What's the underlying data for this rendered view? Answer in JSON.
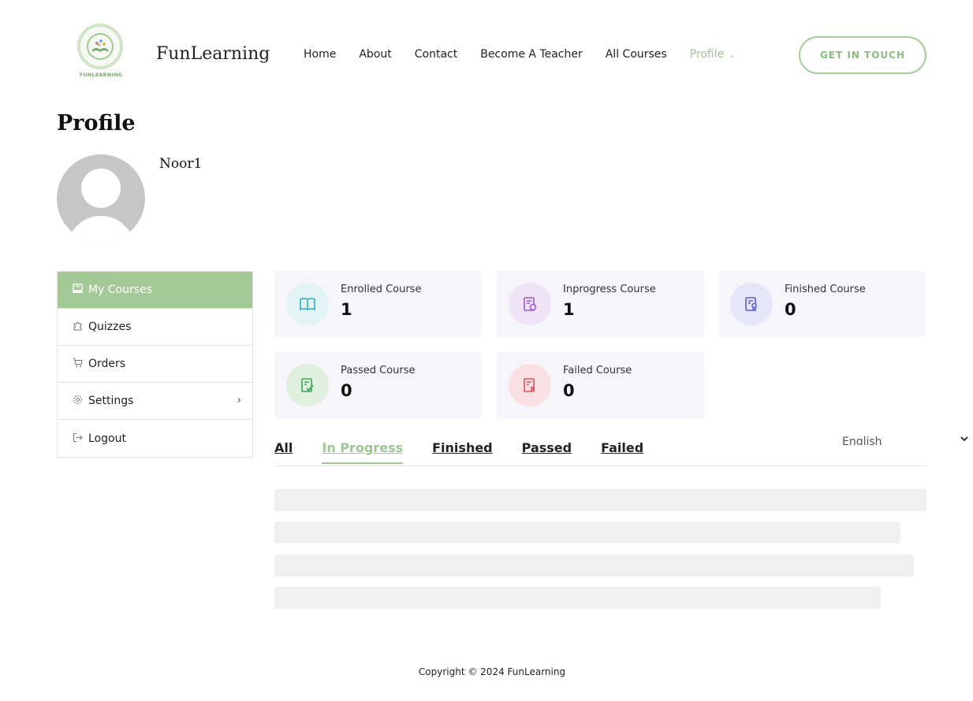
{
  "header": {
    "logo_text": "FUNLEARNING",
    "brand": "FunLearning",
    "nav": [
      {
        "label": "Home"
      },
      {
        "label": "About"
      },
      {
        "label": "Contact"
      },
      {
        "label": "Become A Teacher"
      },
      {
        "label": "All Courses"
      },
      {
        "label": "Profile"
      }
    ],
    "cta_label": "GET IN TOUCH",
    "accent_color": "#9dc793"
  },
  "profile": {
    "title": "Profile",
    "username": "Noor1"
  },
  "sidebar": {
    "items": [
      {
        "label": "My Courses",
        "icon": "courses-icon",
        "active": true
      },
      {
        "label": "Quizzes",
        "icon": "puzzle-icon"
      },
      {
        "label": "Orders",
        "icon": "cart-icon"
      },
      {
        "label": "Settings",
        "icon": "gear-icon",
        "arrow": "›"
      },
      {
        "label": "Logout",
        "icon": "logout-icon"
      }
    ]
  },
  "stats": [
    {
      "label": "Enrolled Course",
      "value": "1",
      "icon": "book-icon",
      "color": "#3fb6c4",
      "bg": "#e3f4f6"
    },
    {
      "label": "Inprogress Course",
      "value": "1",
      "icon": "progress-doc-icon",
      "color": "#9b59d0",
      "bg": "#efe3f8"
    },
    {
      "label": "Finished Course",
      "value": "0",
      "icon": "finished-doc-icon",
      "color": "#5a5fd6",
      "bg": "#e6e6f8"
    },
    {
      "label": "Passed Course",
      "value": "0",
      "icon": "passed-doc-icon",
      "color": "#3aa75a",
      "bg": "#dff0df"
    },
    {
      "label": "Failed Course",
      "value": "0",
      "icon": "failed-doc-icon",
      "color": "#e0505a",
      "bg": "#f9e1e3"
    }
  ],
  "tabs": [
    {
      "label": "All"
    },
    {
      "label": "In Progress",
      "active": true
    },
    {
      "label": "Finished"
    },
    {
      "label": "Passed"
    },
    {
      "label": "Failed"
    }
  ],
  "language": "English",
  "footer": "Copyright © 2024 FunLearning"
}
